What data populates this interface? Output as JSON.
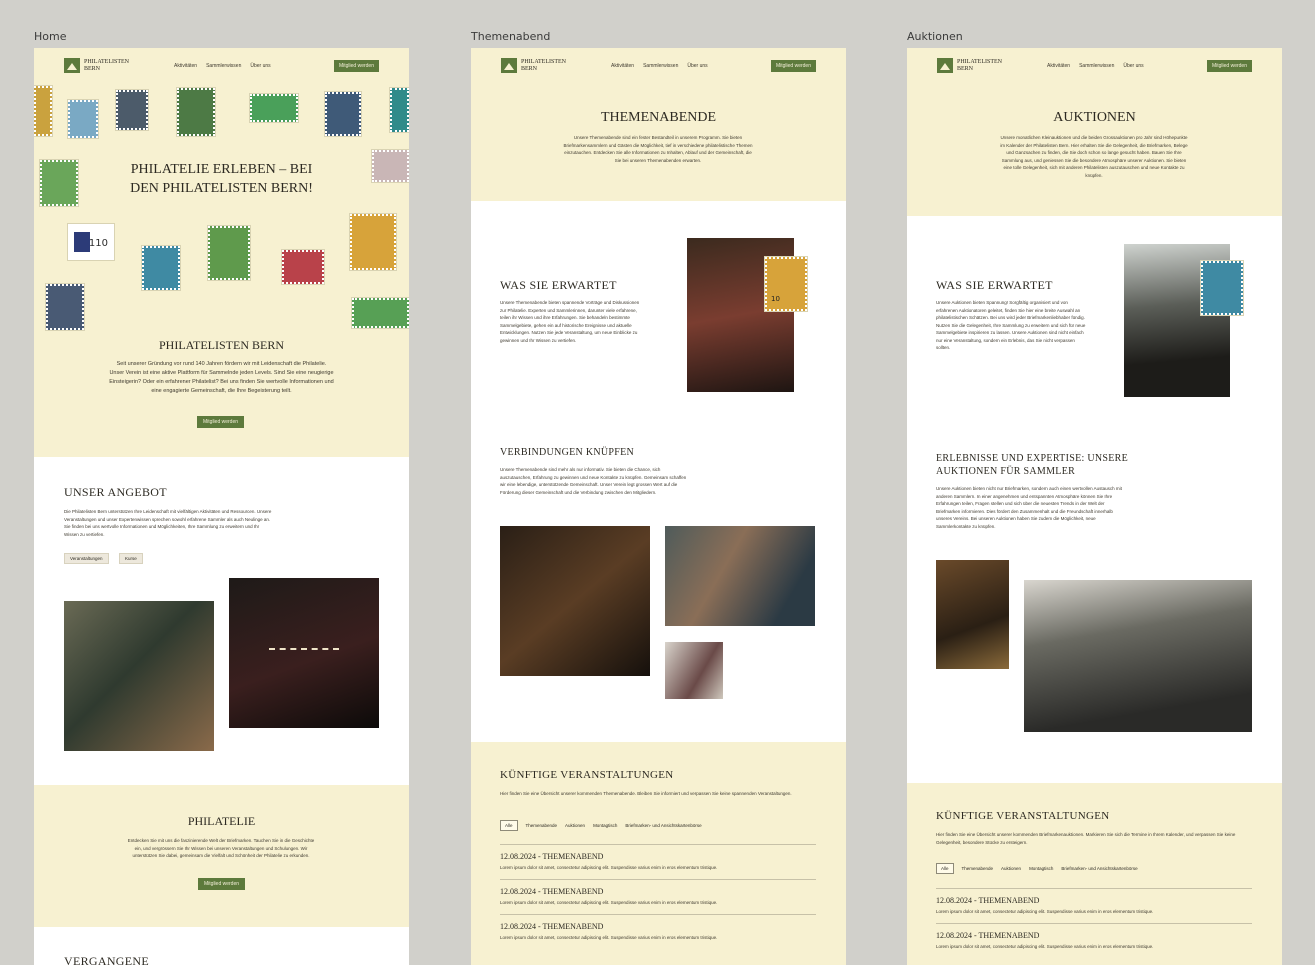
{
  "frames": {
    "home": "Home",
    "themenabend": "Themenabend",
    "auktionen": "Auktionen"
  },
  "logo": {
    "line1": "PHILATELISTEN",
    "line2": "BERN"
  },
  "nav": {
    "links": [
      "Aktivitäten",
      "Sammlerwissen",
      "Über uns"
    ],
    "cta": "Mitglied werden"
  },
  "home": {
    "hero_title": "PHILATELIE ERLEBEN – BEI DEN PHILATELISTEN BERN!",
    "intro_title": "PHILATELISTEN BERN",
    "intro_text": "Seit unserer Gründung vor rund 140 Jahren fördern wir mit Leidenschaft die Philatelie. Unser Verein ist eine aktive Plattform für Sammelnde jeden Levels. Sind Sie eine neugierige Einsteigerin? Oder ein erfahrener Philatelist? Bei uns finden Sie wertvolle Informationen und eine engagierte Gemeinschaft, die Ihre Begeisterung teilt.",
    "intro_button": "Mitglied werden",
    "offer_title": "UNSER ANGEBOT",
    "offer_text": "Die Philatelisten Bern unterstützen Ihre Leidenschaft mit vielfältigen Aktivitäten und Ressourcen. Unsere Veranstaltungen und unser Expertenwissen sprechen sowohl erfahrene Sammler als auch Neulinge an. Sie finden bei uns wertvolle Informationen und Möglichkeiten, Ihre Sammlung zu erweitern und Ihr Wissen zu vertiefen.",
    "offer_pills": [
      "Veranstaltungen",
      "Kurse"
    ],
    "philatelie_title": "PHILATELIE",
    "philatelie_text": "Entdecken Sie mit uns die faszinierende Welt der Briefmarken. Tauchen Sie in die Geschichte ein, und vergrössern Sie Ihr Wissen bei unseren Veranstaltungen und Schulungen. Wir unterstützen Sie dabei, gemeinsam die Vielfalt und Schönheit der Philatelie zu erkunden.",
    "philatelie_button": "Mitglied werden",
    "past_title": "VERGANGENE"
  },
  "themenabend": {
    "hero_title": "THEMENABENDE",
    "hero_text": "Unsere Themenabende sind ein fester Bestandteil in unserem Programm. Sie bieten Briefmarkensammlern und Gästen die Möglichkeit, tief in verschiedene philatelistische Themen einzutauchen. Entdecken Sie alle Informationen zu Inhalten, Ablauf und der Gemeinschaft, die Sie bei unseren Themenabenden erwarten.",
    "expect_title": "WAS SIE ERWARTET",
    "expect_text": "Unsere Themenabende bieten spannende Vorträge und Diskussionen zur Philatelie. Experten und Sammlerinnen, darunter viele erfahrene, teilen ihr Wissen und ihre Erfahrungen. Sie behandeln bestimmte Sammelgebiete, gehen ein auf historische Ereignisse und aktuelle Entwicklungen. Nutzen Sie jede Veranstaltung, um neue Einblicke zu gewinnen und Ihr Wissen zu vertiefen.",
    "connect_title": "VERBINDUNGEN KNÜPFEN",
    "connect_text": "Unsere Themenabende sind mehr als nur informativ. Sie bieten die Chance, sich auszutauschen, Erfahrung zu gewinnen und neue Kontakte zu knüpfen. Gemeinsam schaffen wir eine lebendige, unterstützende Gemeinschaft. Unser Verein legt grossen Wert auf die Förderung dieser Gemeinschaft und die Verbindung zwischen den Mitgliedern.",
    "events_title": "KÜNFTIGE VERANSTALTUNGEN",
    "events_text": "Hier finden Sie eine Übersicht unserer kommenden Themenabende. Bleiben Sie informiert und verpassen Sie keine spannenden Veranstaltungen.",
    "tabs": [
      "Alle",
      "Themenabende",
      "Auktionen",
      "Montagtisch",
      "Briefmarken- und Ansichtskartenbörse"
    ],
    "events": [
      {
        "title": "12.08.2024 - THEMENABEND",
        "desc": "Lorem ipsum dolor sit amet, consectetur adipiscing elit. Suspendisse varius enim in eros elementum tristique."
      },
      {
        "title": "12.08.2024 - THEMENABEND",
        "desc": "Lorem ipsum dolor sit amet, consectetur adipiscing elit. Suspendisse varius enim in eros elementum tristique."
      },
      {
        "title": "12.08.2024 - THEMENABEND",
        "desc": "Lorem ipsum dolor sit amet, consectetur adipiscing elit. Suspendisse varius enim in eros elementum tristique."
      }
    ]
  },
  "auktionen": {
    "hero_title": "AUKTIONEN",
    "hero_text": "Unsere monatlichen Kleinauktionen und die beiden Grossauktionen pro Jahr sind Höhepunkte im Kalender der Philatelisten Bern. Hier erhalten Sie die Gelegenheit, die Briefmarken, Belege und Ganzsachen zu finden, die Sie doch schon so lange gesucht haben. Bauen Sie Ihre Sammlung aus, und geniessen Sie die besondere Atmosphäre unserer Auktionen. Sie bieten eine tolle Gelegenheit, sich mit anderen Philatelisten auszutauschen und neue Kontakte zu knüpfen.",
    "expect_title": "WAS SIE ERWARTET",
    "expect_text": "Unsere Auktionen bieten Spannung! Sorgfältig organisiert und von erfahrenen Auktionatoren geleitet, finden Sie hier eine breite Auswahl an philatelistischen Schätzen. Bei uns wird jeder Briefmarkenliebhaber fündig. Nutzen Sie die Gelegenheit, Ihre Sammlung zu erweitern und sich für neue Sammelgebiete inspirieren zu lassen. Unsere Auktionen sind nicht einfach nur eine Veranstaltung, sondern ein Erlebnis, das Sie nicht verpassen sollten.",
    "expertise_title": "ERLEBNISSE UND EXPERTISE: UNSERE AUKTIONEN FÜR SAMMLER",
    "expertise_text": "Unsere Auktionen bieten nicht nur Briefmarken, sondern auch einen wertvollen Austausch mit anderen Sammlern. In einer angenehmen und entspannten Atmosphäre können Sie Ihre Erfahrungen teilen, Fragen stellen und sich über die neuesten Trends in der Welt der Briefmarken informieren. Dies fördert den Zusammenhalt und die Freundschaft innerhalb unseres Vereins. Bei unseren Auktionen haben Sie zudem die Möglichkeit, neue Sammlerkontakte zu knüpfen.",
    "events_title": "KÜNFTIGE VERANSTALTUNGEN",
    "events_text": "Hier finden Sie eine Übersicht unserer kommenden Briefmarkenauktionen. Markieren Sie sich die Termine in Ihrem Kalender, und verpassen Sie keine Gelegenheit, besondere Stücke zu ersteigern.",
    "tabs": [
      "Alle",
      "Themenabende",
      "Auktionen",
      "Montagtisch",
      "Briefmarken- und Ansichtskartenbörse"
    ],
    "events": [
      {
        "title": "12.08.2024 - THEMENABEND",
        "desc": "Lorem ipsum dolor sit amet, consectetur adipiscing elit. Suspendisse varius enim in eros elementum tristique."
      },
      {
        "title": "12.08.2024 - THEMENABEND",
        "desc": "Lorem ipsum dolor sit amet, consectetur adipiscing elit. Suspendisse varius enim in eros elementum tristique."
      }
    ]
  },
  "stamp_labels": {
    "s110": "110",
    "s10": "10"
  }
}
